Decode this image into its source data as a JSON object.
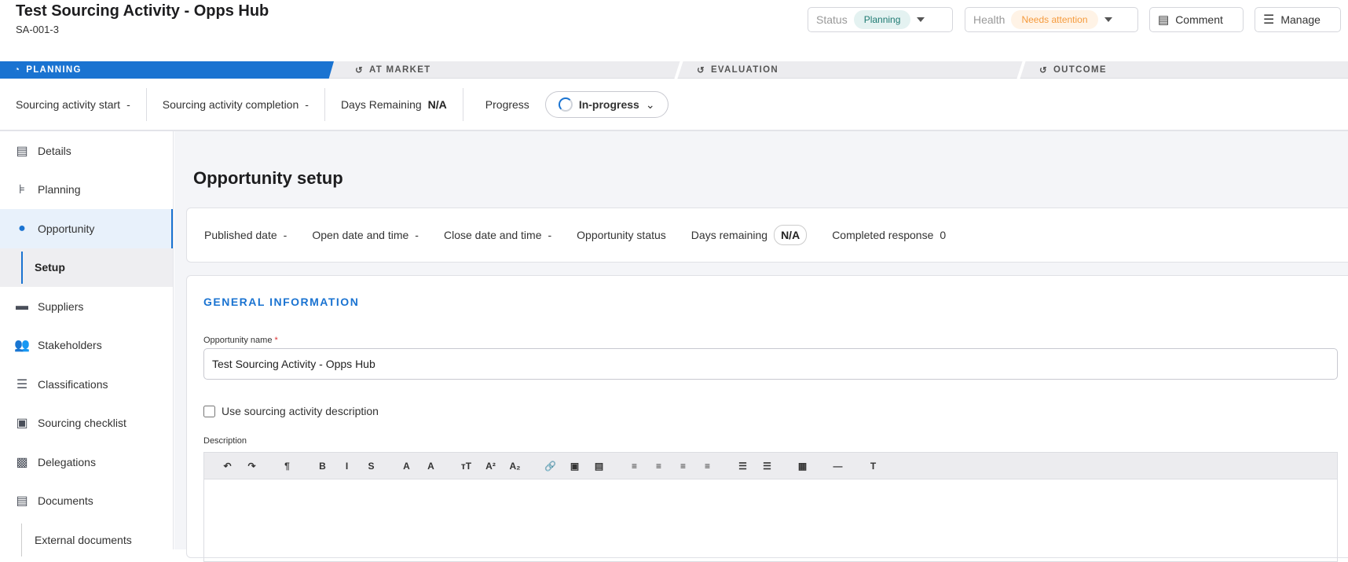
{
  "header": {
    "title": "Test Sourcing Activity - Opps Hub",
    "code": "SA-001-3",
    "status_label": "Status",
    "status_value": "Planning",
    "health_label": "Health",
    "health_value": "Needs attention",
    "comment_label": "Comment",
    "manage_label": "Manage"
  },
  "colors": {
    "accent": "#1a73d1",
    "status_bg": "#e4f2f1",
    "status_fg": "#1e7a72",
    "health_bg": "#fff3e6",
    "health_fg": "#f59a3c"
  },
  "phases": [
    "PLANNING",
    "AT MARKET",
    "EVALUATION",
    "OUTCOME"
  ],
  "metrics": {
    "start_label": "Sourcing activity start",
    "start_value": "-",
    "completion_label": "Sourcing activity completion",
    "completion_value": "-",
    "days_label": "Days Remaining",
    "days_value": "N/A",
    "progress_label": "Progress",
    "progress_value": "In-progress"
  },
  "sidebar": {
    "items": [
      {
        "label": "Details",
        "icon": "details-icon"
      },
      {
        "label": "Planning",
        "icon": "planning-icon"
      },
      {
        "label": "Opportunity",
        "icon": "opportunity-icon"
      },
      {
        "label": "Setup"
      },
      {
        "label": "Suppliers",
        "icon": "store-icon"
      },
      {
        "label": "Stakeholders",
        "icon": "people-icon"
      },
      {
        "label": "Classifications",
        "icon": "list-icon"
      },
      {
        "label": "Sourcing checklist",
        "icon": "checklist-icon"
      },
      {
        "label": "Delegations",
        "icon": "badge-icon"
      },
      {
        "label": "Documents",
        "icon": "document-icon"
      },
      {
        "label": "External documents"
      }
    ]
  },
  "page_title": "Opportunity setup",
  "summary": {
    "published_label": "Published date",
    "published_value": "-",
    "open_label": "Open date and time",
    "open_value": "-",
    "close_label": "Close date and time",
    "close_value": "-",
    "status_label": "Opportunity status",
    "days_label": "Days remaining",
    "days_value": "N/A",
    "completed_label": "Completed response",
    "completed_value": "0"
  },
  "general": {
    "heading": "GENERAL INFORMATION",
    "name_label": "Opportunity name",
    "required": "*",
    "name_value": "Test Sourcing Activity - Opps Hub",
    "checkbox_label": "Use sourcing activity description",
    "description_label": "Description"
  },
  "toolbar": [
    "↶",
    "↷",
    "¶",
    "B",
    "I",
    "S",
    "A",
    "A",
    "тT",
    "A²",
    "A₂",
    "🔗",
    "▣",
    "▤",
    "≡",
    "≡",
    "≡",
    "≡",
    "☰",
    "☰",
    "▦",
    "—",
    "T"
  ]
}
